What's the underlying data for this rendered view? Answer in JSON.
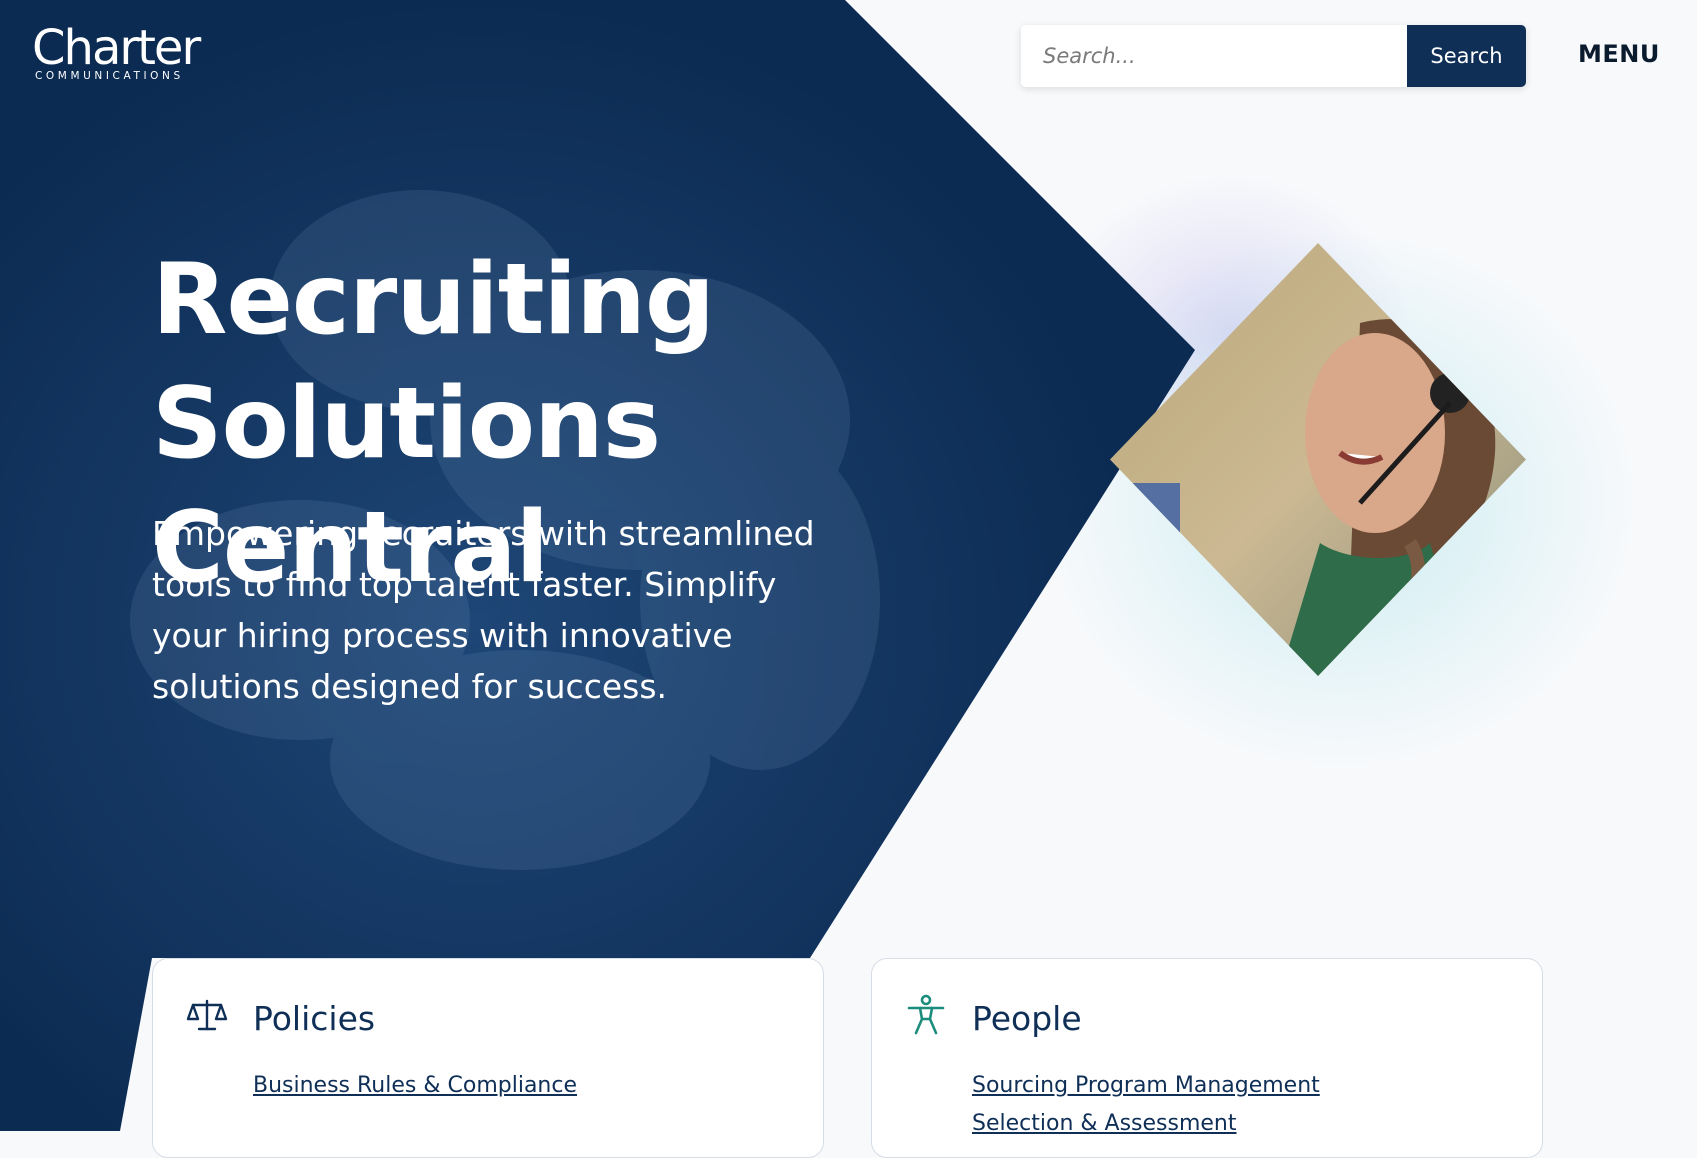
{
  "brand": {
    "logo_word": "Charter",
    "logo_sub": "COMMUNICATIONS"
  },
  "header": {
    "search_placeholder": "Search...",
    "search_button": "Search",
    "menu_label": "MENU"
  },
  "hero": {
    "title_line1": "Recruiting",
    "title_line2": "Solutions Central",
    "description": "Empowering recruiters with streamlined tools to find top talent faster. Simplify your hiring process with innovative solutions designed for success."
  },
  "cards": [
    {
      "title": "Policies",
      "icon": "scales-icon",
      "links": [
        "Business Rules & Compliance"
      ]
    },
    {
      "title": "People",
      "icon": "person-icon",
      "links": [
        "Sourcing Program Management",
        "Selection & Assessment"
      ]
    }
  ],
  "colors": {
    "navy": "#0f2f57",
    "teal": "#1c8d7d",
    "background": "#f7f9fb"
  }
}
